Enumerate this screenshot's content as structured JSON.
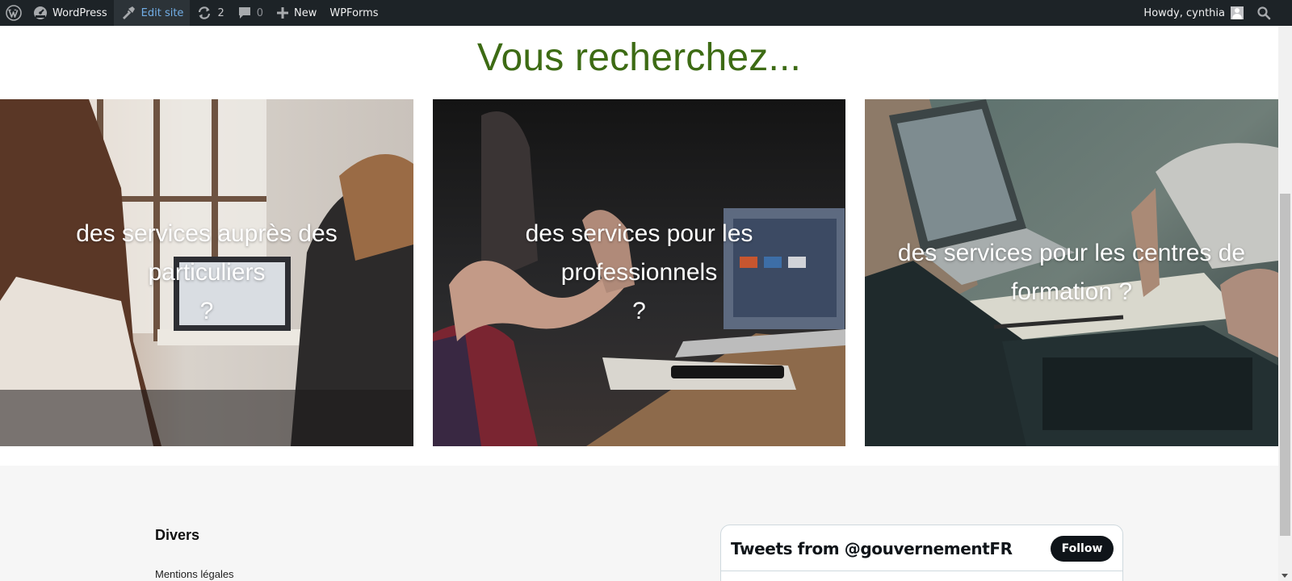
{
  "admin_bar": {
    "items": [
      {
        "icon": "wordpress-logo-icon"
      },
      {
        "icon": "dashboard-icon",
        "label": "WordPress"
      },
      {
        "icon": "brush-icon",
        "label": "Edit site"
      },
      {
        "icon": "updates-icon",
        "count": "2"
      },
      {
        "icon": "comment-icon",
        "count": "0"
      },
      {
        "icon": "plus-icon",
        "label": "New"
      },
      {
        "label": "WPForms"
      }
    ],
    "greeting": "Howdy, cynthia",
    "search_icon": "search-icon",
    "colors": {
      "background": "#1d2327",
      "text": "#f0f0f1",
      "active": "#72aee6"
    }
  },
  "main": {
    "heading": "Vous recherchez...",
    "heading_color": "#3d6b14",
    "cards": [
      {
        "text_line1": "des services auprès des particuliers",
        "text_line2": "?"
      },
      {
        "text_line1": "des services pour les professionnels",
        "text_line2": "?"
      },
      {
        "text_line1": "des services pour les centres de",
        "text_line2": "formation ?"
      }
    ]
  },
  "footer": {
    "heading": "Divers",
    "links": [
      "Mentions légales"
    ],
    "twitter_widget": {
      "title": "Tweets from @gouvernementFR",
      "follow_label": "Follow"
    }
  }
}
